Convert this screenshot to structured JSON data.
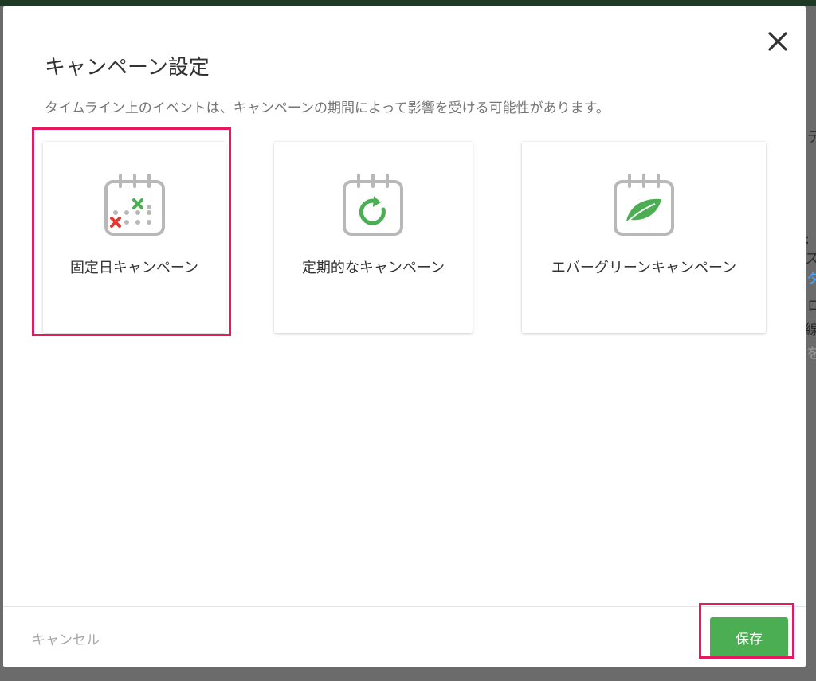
{
  "modal": {
    "title": "キャンペーン設定",
    "description": "タイムライン上のイベントは、キャンペーンの期間によって影響を受ける可能性があります。",
    "close_icon": "close-icon"
  },
  "cards": [
    {
      "label": "固定日キャンペーン",
      "icon": "calendar-fixed-dates-icon",
      "selected": true
    },
    {
      "label": "定期的なキャンペーン",
      "icon": "calendar-recurring-icon",
      "selected": false
    },
    {
      "label": "エバーグリーンキャンペーン",
      "icon": "calendar-leaf-icon",
      "selected": false
    }
  ],
  "footer": {
    "cancel_label": "キャンセル",
    "save_label": "保存"
  },
  "colors": {
    "accent_green": "#4cae52",
    "highlight_pink": "#e8185f",
    "cross_red": "#e53935",
    "icon_gray": "#b8b8b8"
  },
  "background": {
    "fragments": [
      "テ",
      ":ス",
      "タ",
      "ロ",
      "線",
      "を"
    ]
  }
}
